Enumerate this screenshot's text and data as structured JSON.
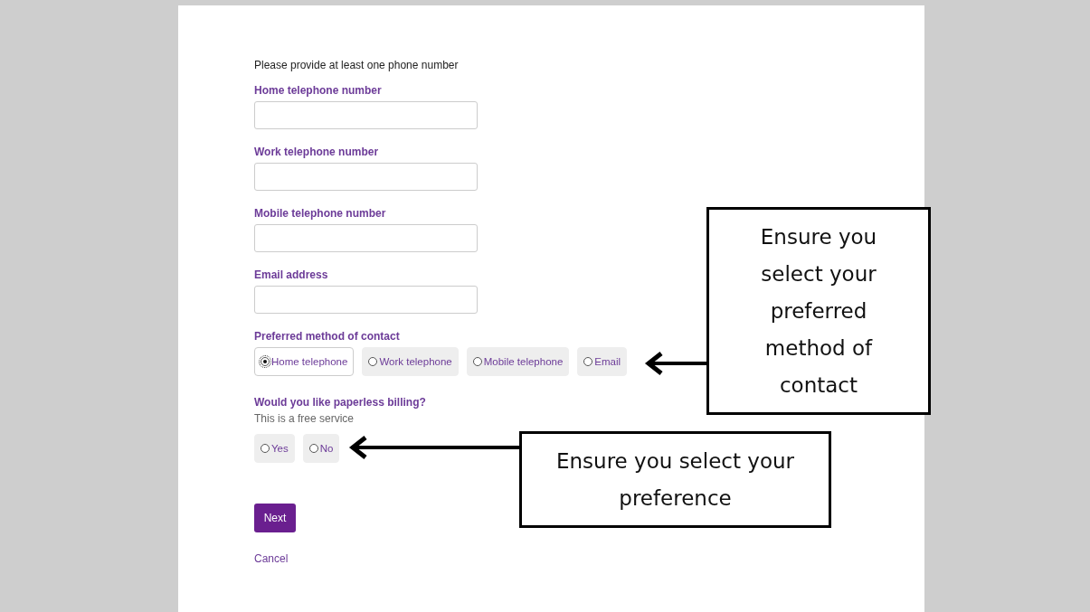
{
  "intro": "Please provide at least one phone number",
  "fields": [
    {
      "label": "Home telephone number"
    },
    {
      "label": "Work telephone number"
    },
    {
      "label": "Mobile telephone number"
    },
    {
      "label": "Email address"
    }
  ],
  "contact_method": {
    "label": "Preferred method of contact",
    "options": [
      {
        "label": "Home telephone",
        "selected": true
      },
      {
        "label": "Work telephone",
        "selected": false
      },
      {
        "label": "Mobile telephone",
        "selected": false
      },
      {
        "label": "Email",
        "selected": false
      }
    ]
  },
  "paperless": {
    "label": "Would you like paperless billing?",
    "hint": "This is a free service",
    "options": [
      {
        "label": "Yes",
        "selected": false
      },
      {
        "label": "No",
        "selected": false
      }
    ]
  },
  "next_button": "Next",
  "cancel_link": "Cancel",
  "callouts": [
    {
      "text": "Ensure you select your preferred method of contact"
    },
    {
      "text": "Ensure you select your preference"
    }
  ]
}
